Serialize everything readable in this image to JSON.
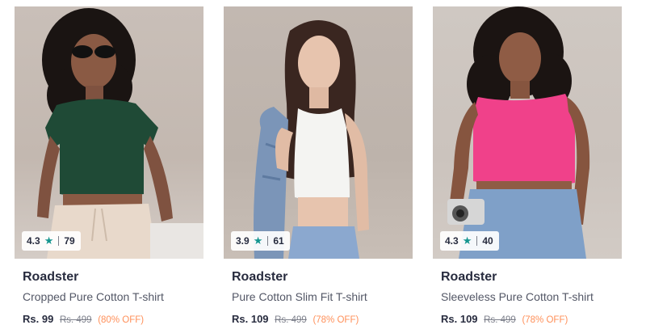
{
  "products": [
    {
      "brand": "Roadster",
      "title": "Cropped Pure Cotton T-shirt",
      "price": "Rs. 99",
      "mrp": "Rs. 499",
      "discount": "(80% OFF)",
      "rating": "4.3",
      "rating_count": "79",
      "garment_color": "#1f4a36"
    },
    {
      "brand": "Roadster",
      "title": "Pure Cotton Slim Fit T-shirt",
      "price": "Rs. 109",
      "mrp": "Rs. 499",
      "discount": "(78% OFF)",
      "rating": "3.9",
      "rating_count": "61",
      "garment_color": "#f4f4f2"
    },
    {
      "brand": "Roadster",
      "title": "Sleeveless Pure Cotton T-shirt",
      "price": "Rs. 109",
      "mrp": "Rs. 499",
      "discount": "(78% OFF)",
      "rating": "4.3",
      "rating_count": "40",
      "garment_color": "#f0418a"
    }
  ],
  "colors": {
    "star": "#14958f",
    "discount": "#ff905a",
    "brand_text": "#282c3f"
  },
  "icons": {
    "rating": "star-icon"
  }
}
